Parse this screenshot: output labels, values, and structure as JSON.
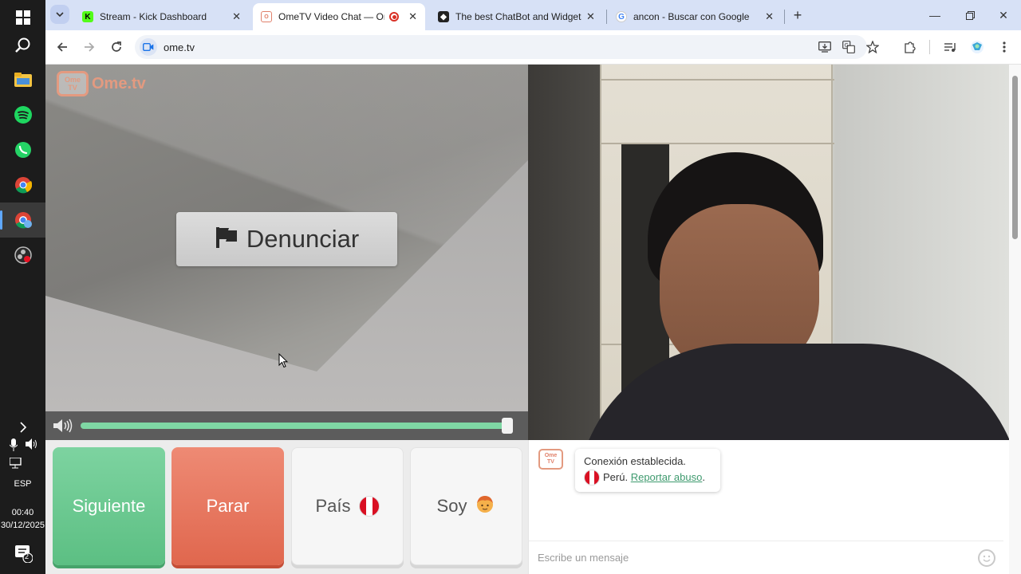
{
  "taskbar": {
    "apps": [
      "start",
      "search",
      "file-explorer",
      "spotify",
      "whatsapp",
      "chrome",
      "chrome-profile",
      "obs"
    ],
    "language": "ESP",
    "time": "00:40",
    "date": "30/12/2025",
    "notification_count": "2"
  },
  "tabs": [
    {
      "title": "Stream - Kick Dashboard",
      "favicon": "K",
      "color": "#53fc18"
    },
    {
      "title": "OmeTV Video Chat — Ome",
      "favicon": "O",
      "color": "#e0806a"
    },
    {
      "title": "The best ChatBot and Widgets",
      "favicon": "◆",
      "color": "#222222"
    },
    {
      "title": "ancon - Buscar con Google",
      "favicon": "G",
      "color": "#4285f4"
    }
  ],
  "address": {
    "url": "ome.tv"
  },
  "page": {
    "logo_text": "Ome.tv",
    "logo_small_1": "Ome",
    "logo_small_2": "TV",
    "report_label": "Denunciar",
    "volume_level": 0.99,
    "buttons": {
      "next": "Siguiente",
      "stop": "Parar",
      "country": "País",
      "gender": "Soy"
    },
    "chat": {
      "message": "Conexión establecida.",
      "country": "Perú.",
      "report_link": "Reportar abuso",
      "period": ".",
      "input_placeholder": "Escribe un mensaje"
    }
  },
  "colors": {
    "accent_green": "#5cbf83",
    "accent_red": "#e0674e",
    "brand": "#e39a80"
  }
}
